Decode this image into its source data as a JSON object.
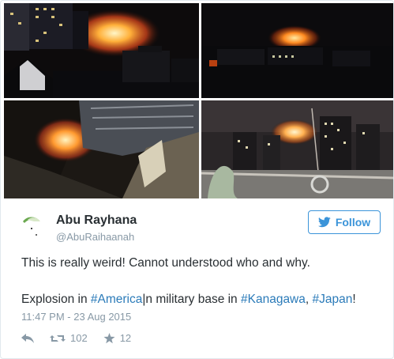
{
  "tweet": {
    "author_name": "Abu Rayhana",
    "author_handle": "@AbuRaihaanah",
    "follow_label": "Follow",
    "line1": "This is really weird! Cannot understood who and why.",
    "line2_part1": "Explosion in ",
    "hashtag1": "#America",
    "line2_part2": "|n military base in ",
    "hashtag2": "#Kanagawa",
    "line2_part3": ", ",
    "hashtag3": "#Japan",
    "line2_part4": "!",
    "timestamp": "11:47 PM - 23 Aug 2015",
    "retweets": "102",
    "favorites": "12"
  },
  "icons": {
    "follow": "twitter-bird-icon",
    "reply": "reply-arrow-icon",
    "retweet": "retweet-icon",
    "favorite": "star-icon"
  },
  "colors": {
    "link": "#2b7bb9",
    "follow_blue": "#3b94d9",
    "muted": "#8899a6",
    "text": "#292f33",
    "border": "#e1e8ed"
  }
}
